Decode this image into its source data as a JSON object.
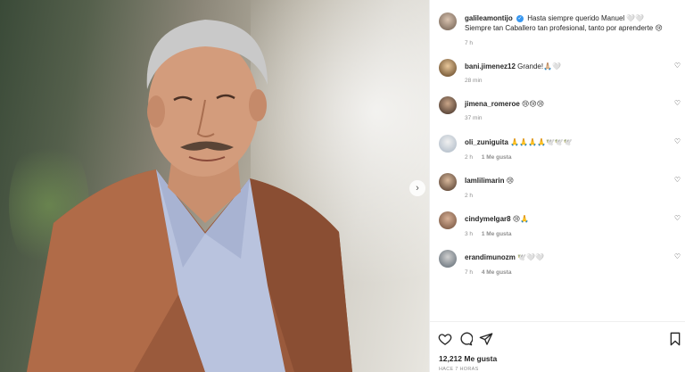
{
  "post": {
    "username": "galileamontijo",
    "caption": "Hasta siempre querido Manuel 🤍🤍 Siempre tan Caballero tan profesional, tanto por aprenderte 😢",
    "time": "7 h"
  },
  "comments": [
    {
      "username": "bani.jimenez12",
      "text": "Grande!🙏🏼🤍",
      "time": "28 min",
      "likes": ""
    },
    {
      "username": "jimena_romeroe",
      "text": "😢😢😢",
      "time": "37 min",
      "likes": ""
    },
    {
      "username": "oli_zuniguita",
      "text": "🙏🙏🙏🙏🕊️🕊️🕊️",
      "time": "2 h",
      "likes": "1 Me gusta"
    },
    {
      "username": "lamlilimarin",
      "text": "😢",
      "time": "2 h",
      "likes": ""
    },
    {
      "username": "cindymelgar8",
      "text": "😢🙏",
      "time": "3 h",
      "likes": "1 Me gusta"
    },
    {
      "username": "erandimunozm",
      "text": "🕊️🤍🤍",
      "time": "7 h",
      "likes": "4 Me gusta"
    }
  ],
  "footer": {
    "likes_count": "12,212 Me gusta",
    "time_ago": "HACE 7 HORAS"
  },
  "colors": {
    "verified": "#3897f0",
    "muted": "#8e8e8e",
    "text": "#262626"
  }
}
